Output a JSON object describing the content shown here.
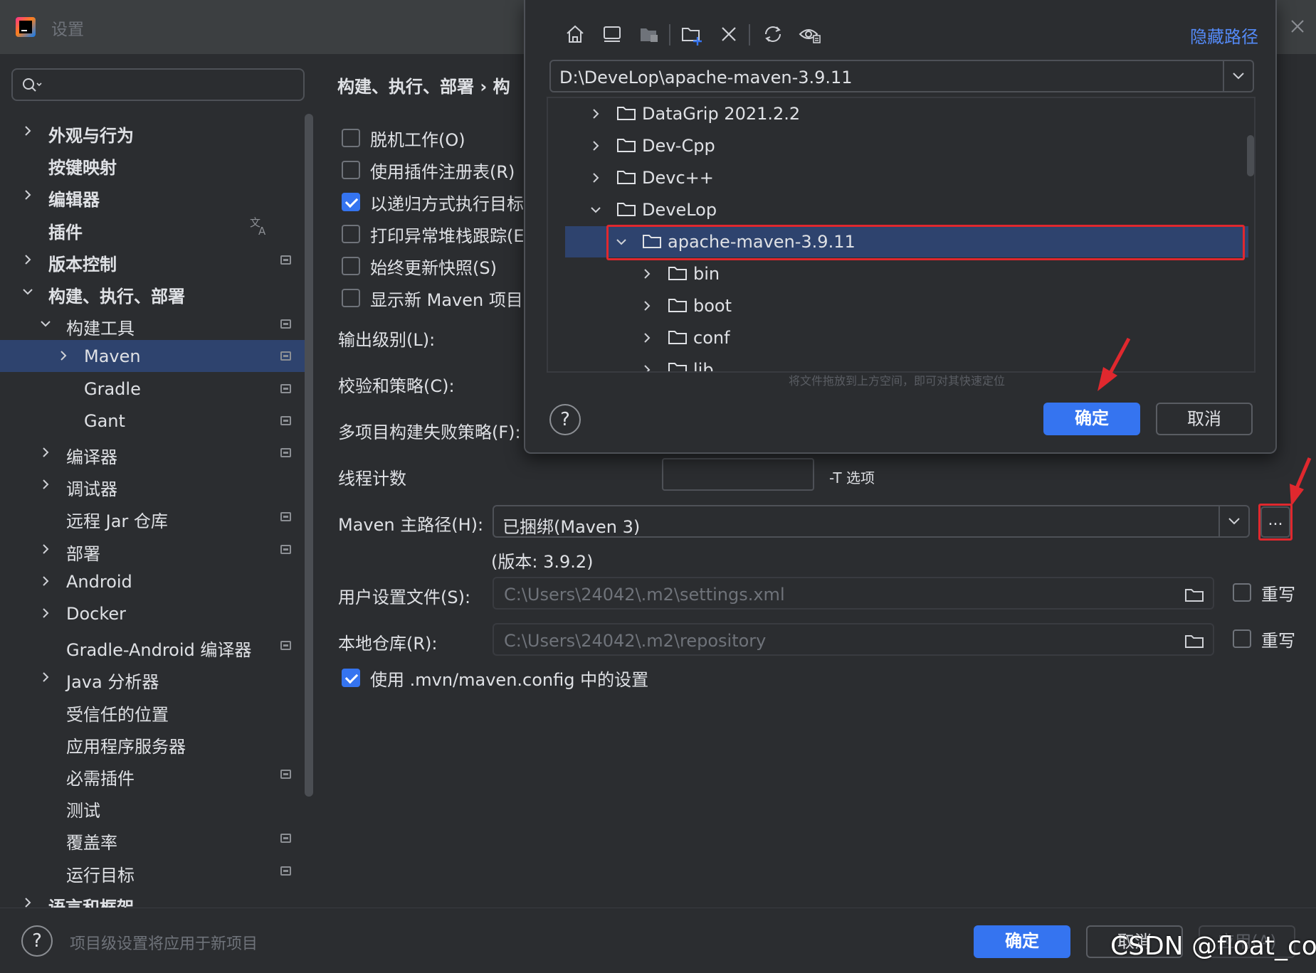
{
  "window": {
    "title": "设置"
  },
  "search": {
    "placeholder": ""
  },
  "sidebar": {
    "items": [
      {
        "label": "外观与行为",
        "level": 0,
        "expand": "collapsed",
        "bold": true,
        "marker": false
      },
      {
        "label": "按键映射",
        "level": 0,
        "expand": "none",
        "bold": true,
        "marker": false
      },
      {
        "label": "编辑器",
        "level": 0,
        "expand": "collapsed",
        "bold": true,
        "marker": false
      },
      {
        "label": "插件",
        "level": 0,
        "expand": "none",
        "bold": true,
        "marker": false
      },
      {
        "label": "版本控制",
        "level": 0,
        "expand": "collapsed",
        "bold": true,
        "marker": true
      },
      {
        "label": "构建、执行、部署",
        "level": 0,
        "expand": "expanded",
        "bold": true,
        "marker": false
      },
      {
        "label": "构建工具",
        "level": 1,
        "expand": "expanded",
        "bold": false,
        "marker": true
      },
      {
        "label": "Maven",
        "level": 2,
        "expand": "collapsed",
        "bold": false,
        "marker": true,
        "selected": true
      },
      {
        "label": "Gradle",
        "level": 2,
        "expand": "none",
        "bold": false,
        "marker": true
      },
      {
        "label": "Gant",
        "level": 2,
        "expand": "none",
        "bold": false,
        "marker": true
      },
      {
        "label": "编译器",
        "level": 1,
        "expand": "collapsed",
        "bold": false,
        "marker": true
      },
      {
        "label": "调试器",
        "level": 1,
        "expand": "collapsed",
        "bold": false,
        "marker": false
      },
      {
        "label": "远程 Jar 仓库",
        "level": 1,
        "expand": "none",
        "bold": false,
        "marker": true
      },
      {
        "label": "部署",
        "level": 1,
        "expand": "collapsed",
        "bold": false,
        "marker": true
      },
      {
        "label": "Android",
        "level": 1,
        "expand": "collapsed",
        "bold": false,
        "marker": false
      },
      {
        "label": "Docker",
        "level": 1,
        "expand": "collapsed",
        "bold": false,
        "marker": false
      },
      {
        "label": "Gradle-Android 编译器",
        "level": 1,
        "expand": "none",
        "bold": false,
        "marker": true
      },
      {
        "label": "Java 分析器",
        "level": 1,
        "expand": "collapsed",
        "bold": false,
        "marker": false
      },
      {
        "label": "受信任的位置",
        "level": 1,
        "expand": "none",
        "bold": false,
        "marker": false
      },
      {
        "label": "应用程序服务器",
        "level": 1,
        "expand": "none",
        "bold": false,
        "marker": false
      },
      {
        "label": "必需插件",
        "level": 1,
        "expand": "none",
        "bold": false,
        "marker": true
      },
      {
        "label": "测试",
        "level": 1,
        "expand": "none",
        "bold": false,
        "marker": false
      },
      {
        "label": "覆盖率",
        "level": 1,
        "expand": "none",
        "bold": false,
        "marker": true
      },
      {
        "label": "运行目标",
        "level": 1,
        "expand": "none",
        "bold": false,
        "marker": true
      },
      {
        "label": "语言和框架",
        "level": 0,
        "expand": "collapsed",
        "bold": true,
        "marker": false
      }
    ]
  },
  "main": {
    "breadcrumb": "构建、执行、部署 › 构",
    "checkboxes": [
      {
        "label": "脱机工作(O)",
        "checked": false
      },
      {
        "label": "使用插件注册表(R)",
        "checked": false
      },
      {
        "label": "以递归方式执行目标",
        "checked": true
      },
      {
        "label": "打印异常堆栈跟踪(E)",
        "checked": false
      },
      {
        "label": "始终更新快照(S)",
        "checked": false
      },
      {
        "label": "显示新 Maven 项目的",
        "checked": false
      }
    ],
    "output_level_label": "输出级别(L):",
    "checksum_policy_label": "校验和策略(C):",
    "multiproject_fail_label": "多项目构建失败策略(F):",
    "thread_count_label": "线程计数",
    "thread_count_value": "",
    "t_option_label": "-T 选项",
    "maven_home_label": "Maven 主路径(H):",
    "maven_home_value": "已捆绑(Maven 3)",
    "browse_label": "...",
    "maven_version": "(版本: 3.9.2)",
    "user_settings_label": "用户设置文件(S):",
    "user_settings_value": "C:\\Users\\24042\\.m2\\settings.xml",
    "local_repo_label": "本地仓库(R):",
    "local_repo_value": "C:\\Users\\24042\\.m2\\repository",
    "override_label": "重写",
    "use_mvn_config_label": "使用 .mvn/maven.config 中的设置",
    "use_mvn_config_checked": true
  },
  "bottom": {
    "help": "?",
    "note": "项目级设置将应用于新项目",
    "ok": "确定",
    "cancel": "取消",
    "apply": "应用(A)"
  },
  "dialog": {
    "hide_path": "隐藏路径",
    "path": "D:\\DeveLop\\apache-maven-3.9.11",
    "toolbar_icons": [
      "home-icon",
      "desktop-icon",
      "project-icon",
      "new-folder-icon",
      "delete-icon",
      "refresh-icon",
      "show-hidden-icon"
    ],
    "tree": [
      {
        "name": "DataGrip 2021.2.2",
        "depth": 0,
        "expand": "collapsed"
      },
      {
        "name": "Dev-Cpp",
        "depth": 0,
        "expand": "collapsed"
      },
      {
        "name": "Devc++",
        "depth": 0,
        "expand": "collapsed"
      },
      {
        "name": "DeveLop",
        "depth": 0,
        "expand": "expanded"
      },
      {
        "name": "apache-maven-3.9.11",
        "depth": 1,
        "expand": "expanded",
        "selected": true
      },
      {
        "name": "bin",
        "depth": 2,
        "expand": "collapsed"
      },
      {
        "name": "boot",
        "depth": 2,
        "expand": "collapsed"
      },
      {
        "name": "conf",
        "depth": 2,
        "expand": "collapsed"
      },
      {
        "name": "lib",
        "depth": 2,
        "expand": "collapsed"
      }
    ],
    "drag_hint": "将文件拖放到上方空间，即可对其快速定位",
    "help": "?",
    "ok": "确定",
    "cancel": "取消"
  },
  "watermark": "CSDN @float_com",
  "colors": {
    "accent": "#3574f0",
    "annotation_red": "#e0282e",
    "selection": "#2e436e",
    "link": "#548af7"
  }
}
